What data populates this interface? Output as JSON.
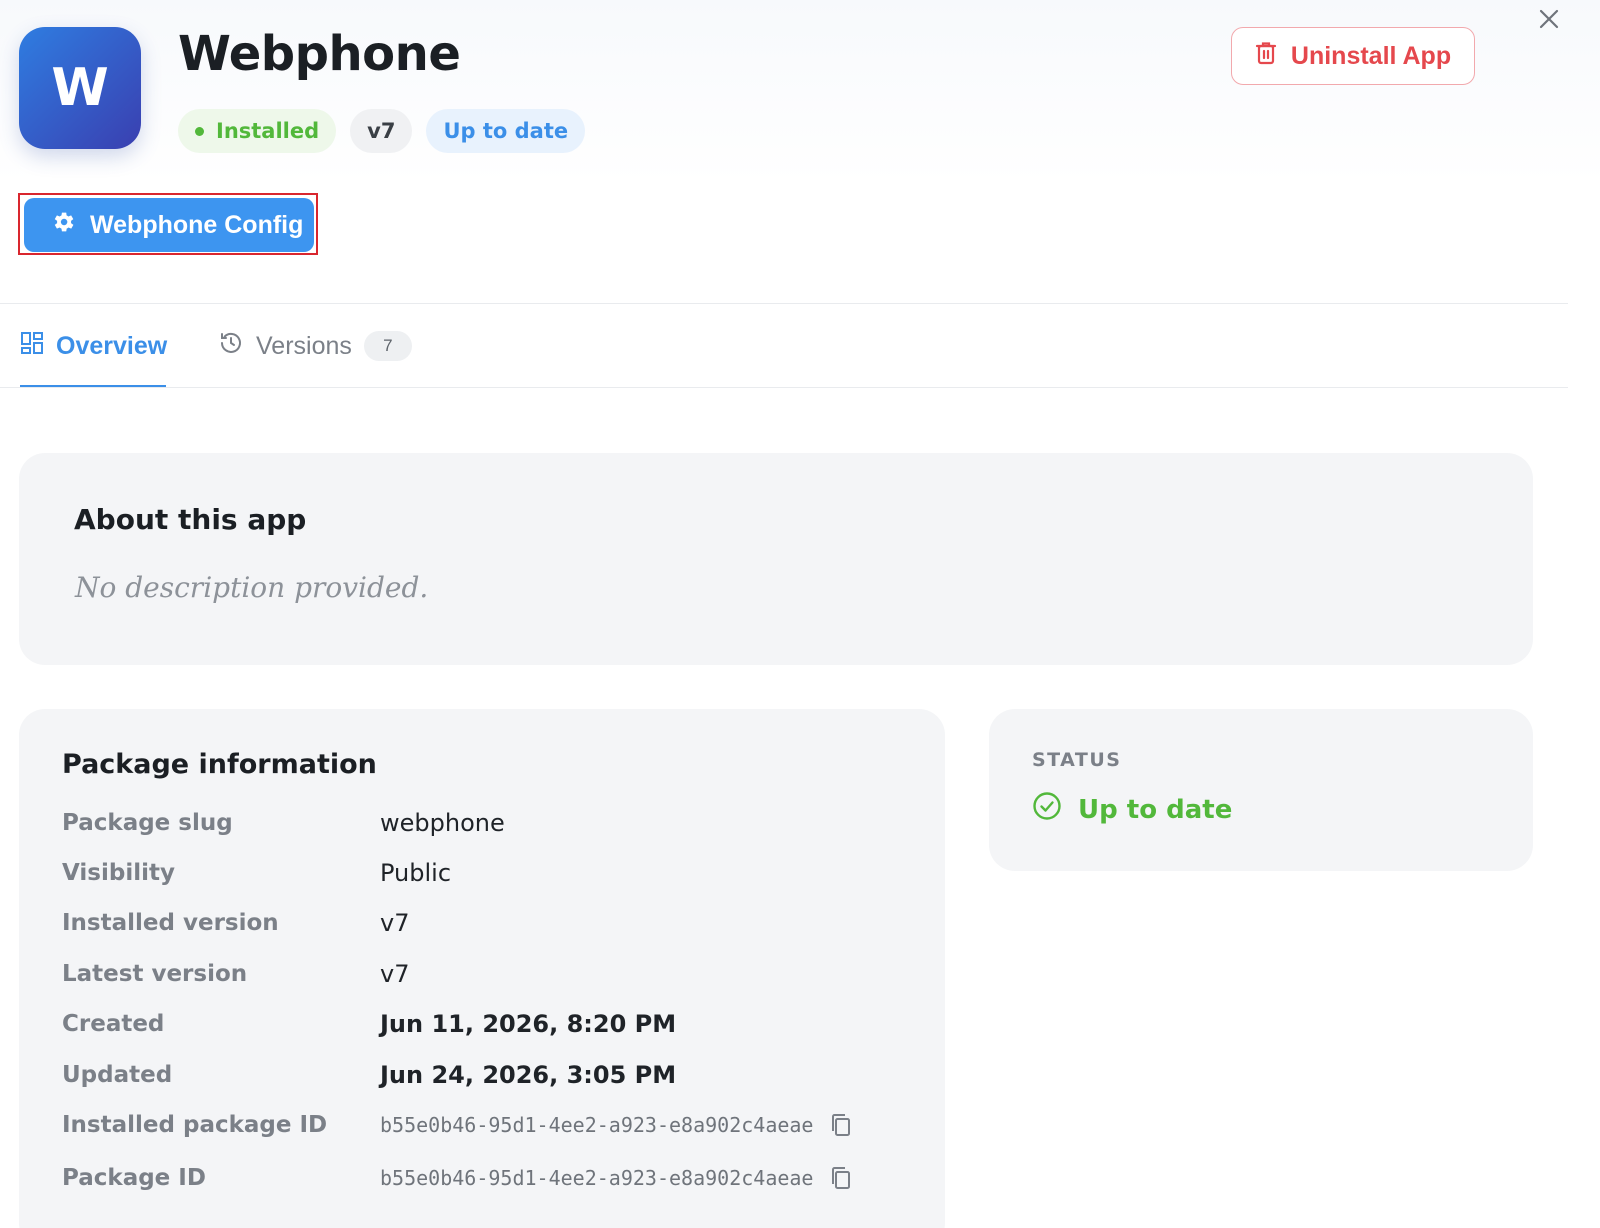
{
  "app": {
    "icon_letter": "W",
    "name": "Webphone",
    "badges": {
      "installed": "Installed",
      "version": "v7",
      "update_status": "Up to date"
    }
  },
  "actions": {
    "uninstall_label": "Uninstall App",
    "config_label": "Webphone Config"
  },
  "tabs": [
    {
      "label": "Overview",
      "active": true
    },
    {
      "label": "Versions",
      "count": "7",
      "active": false
    }
  ],
  "about": {
    "heading": "About this app",
    "description": "No description provided."
  },
  "package_info": {
    "heading": "Package information",
    "rows": [
      {
        "label": "Package slug",
        "value": "webphone"
      },
      {
        "label": "Visibility",
        "value": "Public"
      },
      {
        "label": "Installed version",
        "value": "v7"
      },
      {
        "label": "Latest version",
        "value": "v7"
      },
      {
        "label": "Created",
        "value": "Jun 11, 2026, 8:20 PM"
      },
      {
        "label": "Updated",
        "value": "Jun 24, 2026, 3:05 PM"
      },
      {
        "label": "Installed package ID",
        "value": "b55e0b46-95d1-4ee2-a923-e8a902c4aeae"
      },
      {
        "label": "Package ID",
        "value": "b55e0b46-95d1-4ee2-a923-e8a902c4aeae"
      }
    ]
  },
  "status_card": {
    "caption": "STATUS",
    "value": "Up to date"
  },
  "colors": {
    "primary": "#3d95f0",
    "success": "#52b83b",
    "danger": "#e5484d",
    "highlight_border": "#d9262e"
  }
}
